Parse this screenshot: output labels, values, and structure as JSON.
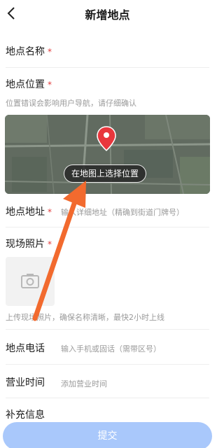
{
  "header": {
    "title": "新增地点"
  },
  "form": {
    "name_label": "地点名称",
    "location_label": "地点位置",
    "location_hint": "位置错误会影响用户导航，请仔细确认",
    "map_button": "在地图上选择位置",
    "address_label": "地点地址",
    "address_placeholder": "输入详细地址（精确到街道门牌号）",
    "photo_label": "现场照片",
    "photo_hint": "上传现场照片，确保名称清晰，最快2小时上线",
    "phone_label": "地点电话",
    "phone_placeholder": "输入手机或固话（需带区号）",
    "hours_label": "营业时间",
    "hours_placeholder": "添加营业时间",
    "extra_label": "补充信息",
    "required_mark": "*"
  },
  "footer": {
    "submit_label": "提交"
  },
  "colors": {
    "required": "#e23b3b",
    "submit_bg": "#a9c8fb",
    "arrow": "#f26a2e",
    "pin": "#e8373d"
  },
  "icons": {
    "back": "chevron-left-icon",
    "pin": "map-pin-icon",
    "camera": "camera-icon"
  }
}
